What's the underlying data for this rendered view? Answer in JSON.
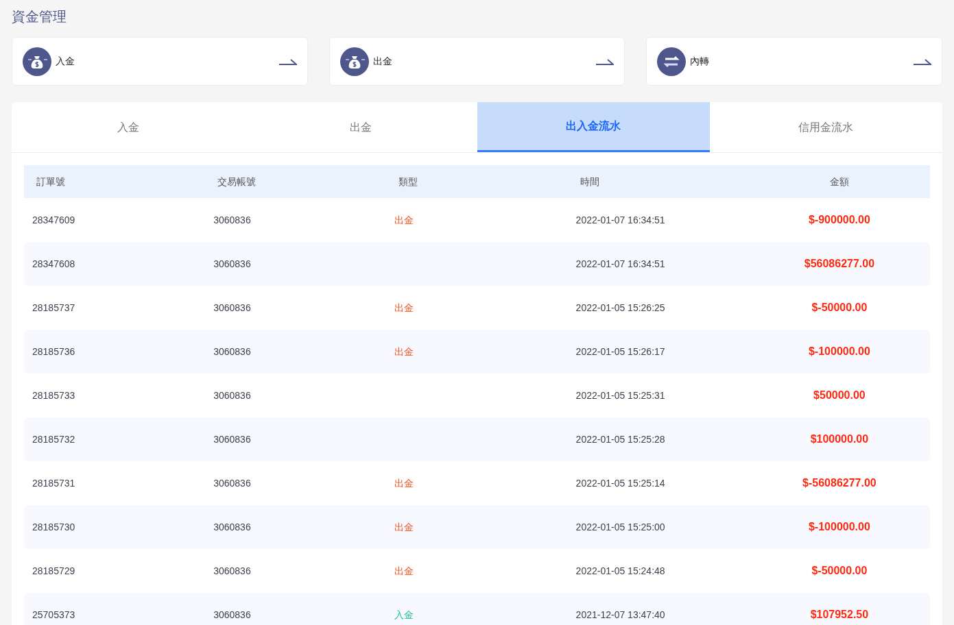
{
  "page_title": "資金管理",
  "actions": [
    {
      "label": "入金",
      "kind": "money"
    },
    {
      "label": "出金",
      "kind": "money"
    },
    {
      "label": "內轉",
      "kind": "transfer"
    }
  ],
  "tabs": [
    {
      "label": "入金",
      "selected": false
    },
    {
      "label": "出金",
      "selected": false
    },
    {
      "label": "出入金流水",
      "selected": true
    },
    {
      "label": "信用金流水",
      "selected": false
    }
  ],
  "table": {
    "columns": [
      "訂單號",
      "交易帳號",
      "類型",
      "時間",
      "金額"
    ],
    "rows": [
      {
        "order": "28347609",
        "account": "3060836",
        "type": {
          "label": "出金",
          "kind": "withdraw"
        },
        "time": "2022-01-07 16:34:51",
        "amount": "$-900000.00"
      },
      {
        "order": "28347608",
        "account": "3060836",
        "time": "2022-01-07 16:34:51",
        "amount": "$56086277.00"
      },
      {
        "order": "28185737",
        "account": "3060836",
        "type": {
          "label": "出金",
          "kind": "withdraw"
        },
        "time": "2022-01-05 15:26:25",
        "amount": "$-50000.00"
      },
      {
        "order": "28185736",
        "account": "3060836",
        "type": {
          "label": "出金",
          "kind": "withdraw"
        },
        "time": "2022-01-05 15:26:17",
        "amount": "$-100000.00"
      },
      {
        "order": "28185733",
        "account": "3060836",
        "time": "2022-01-05 15:25:31",
        "amount": "$50000.00"
      },
      {
        "order": "28185732",
        "account": "3060836",
        "time": "2022-01-05 15:25:28",
        "amount": "$100000.00"
      },
      {
        "order": "28185731",
        "account": "3060836",
        "type": {
          "label": "出金",
          "kind": "withdraw"
        },
        "time": "2022-01-05 15:25:14",
        "amount": "$-56086277.00"
      },
      {
        "order": "28185730",
        "account": "3060836",
        "type": {
          "label": "出金",
          "kind": "withdraw"
        },
        "time": "2022-01-05 15:25:00",
        "amount": "$-100000.00"
      },
      {
        "order": "28185729",
        "account": "3060836",
        "type": {
          "label": "出金",
          "kind": "withdraw"
        },
        "time": "2022-01-05 15:24:48",
        "amount": "$-50000.00"
      },
      {
        "order": "25705373",
        "account": "3060836",
        "type": {
          "label": "入金",
          "kind": "deposit"
        },
        "time": "2021-12-07 13:47:40",
        "amount": "$107952.50"
      }
    ]
  }
}
